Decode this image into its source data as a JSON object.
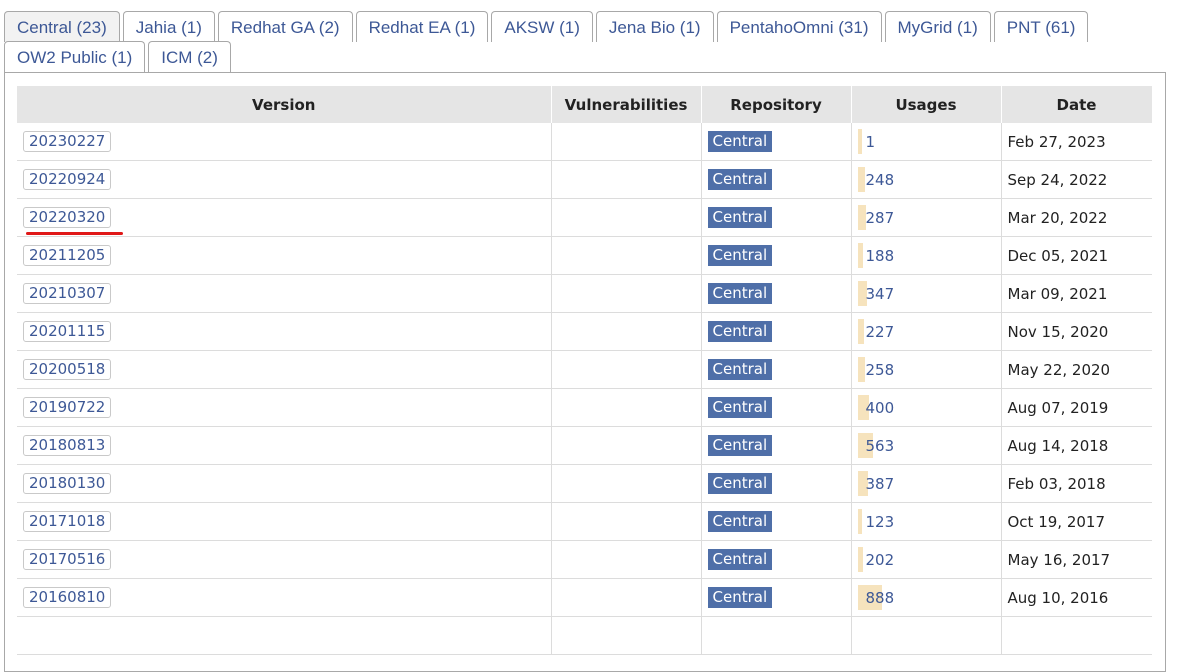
{
  "tabs": [
    {
      "label": "Central (23)",
      "active": true
    },
    {
      "label": "Jahia (1)"
    },
    {
      "label": "Redhat GA (2)"
    },
    {
      "label": "Redhat EA (1)"
    },
    {
      "label": "AKSW (1)"
    },
    {
      "label": "Jena Bio (1)"
    },
    {
      "label": "PentahoOmni (31)"
    },
    {
      "label": "MyGrid (1)"
    },
    {
      "label": "PNT (61)"
    },
    {
      "label": "OW2 Public (1)"
    },
    {
      "label": "ICM (2)"
    }
  ],
  "table": {
    "headers": [
      "Version",
      "Vulnerabilities",
      "Repository",
      "Usages",
      "Date"
    ],
    "max_usage": 888,
    "rows": [
      {
        "version": "20230227",
        "repository": "Central",
        "usages": "1",
        "date": "Feb 27, 2023"
      },
      {
        "version": "20220924",
        "repository": "Central",
        "usages": "248",
        "date": "Sep 24, 2022"
      },
      {
        "version": "20220320",
        "repository": "Central",
        "usages": "287",
        "date": "Mar 20, 2022",
        "marked": true
      },
      {
        "version": "20211205",
        "repository": "Central",
        "usages": "188",
        "date": "Dec 05, 2021"
      },
      {
        "version": "20210307",
        "repository": "Central",
        "usages": "347",
        "date": "Mar 09, 2021"
      },
      {
        "version": "20201115",
        "repository": "Central",
        "usages": "227",
        "date": "Nov 15, 2020"
      },
      {
        "version": "20200518",
        "repository": "Central",
        "usages": "258",
        "date": "May 22, 2020"
      },
      {
        "version": "20190722",
        "repository": "Central",
        "usages": "400",
        "date": "Aug 07, 2019"
      },
      {
        "version": "20180813",
        "repository": "Central",
        "usages": "563",
        "date": "Aug 14, 2018"
      },
      {
        "version": "20180130",
        "repository": "Central",
        "usages": "387",
        "date": "Feb 03, 2018"
      },
      {
        "version": "20171018",
        "repository": "Central",
        "usages": "123",
        "date": "Oct 19, 2017"
      },
      {
        "version": "20170516",
        "repository": "Central",
        "usages": "202",
        "date": "May 16, 2017"
      },
      {
        "version": "20160810",
        "repository": "Central",
        "usages": "888",
        "date": "Aug 10, 2016"
      },
      {
        "version": "",
        "repository": "",
        "usages": "",
        "date": ""
      }
    ]
  },
  "colors": {
    "link": "#3d5896",
    "badge": "#4f6fa8",
    "usage_bar": "#f6e3bd",
    "annotation": "#e01818"
  }
}
